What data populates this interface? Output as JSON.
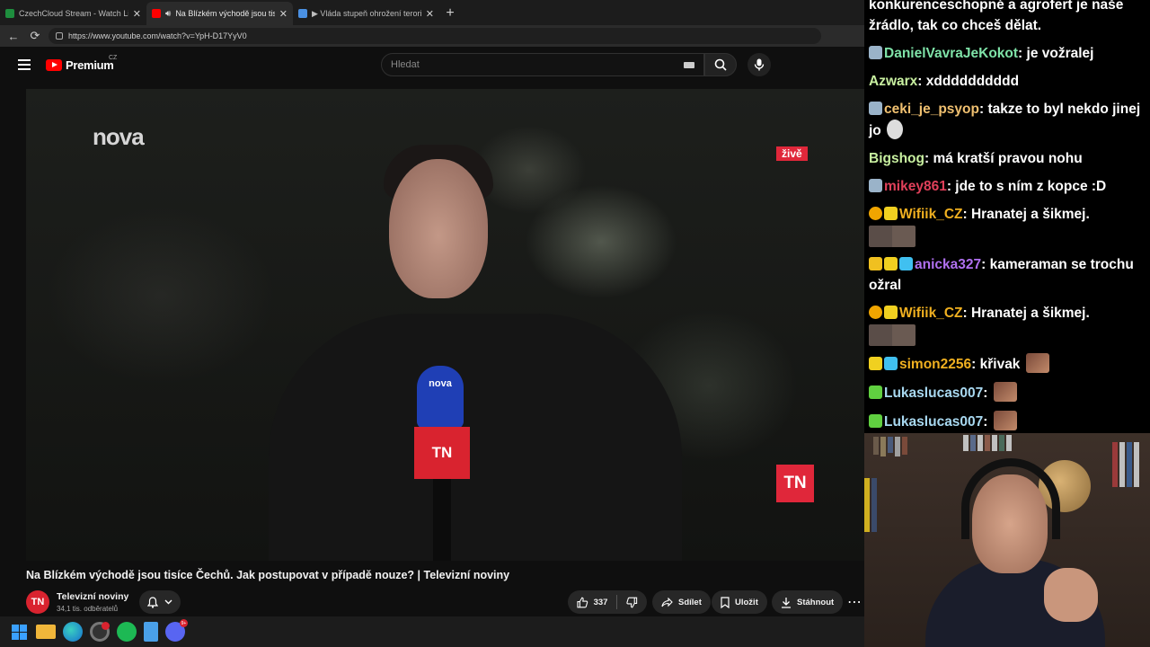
{
  "browser": {
    "tabs": [
      {
        "title": "CzechCloud Stream - Watch Live o",
        "favicon_color": "#1e8e3e",
        "active": false
      },
      {
        "title": "Na Blízkém východě jsou tisíce",
        "favicon_color": "#ff0000",
        "active": true
      },
      {
        "title": "▶ Vláda stupeň ohrožení terorism",
        "favicon_color": "#4a90e2",
        "active": false
      }
    ],
    "tab_close_glyph": "✕",
    "new_tab_glyph": "+",
    "url": "https://www.youtube.com/watch?v=YpH-D17YyV0"
  },
  "youtube": {
    "logo_text": "Premium",
    "region": "CZ",
    "search_placeholder": "Hledat",
    "video": {
      "channel_watermark": "nova",
      "live_badge": "živě",
      "corner_logo": "TN",
      "mic_logo": "nova",
      "mic_flag": "TN",
      "title": "Na Blízkém východě jsou tisíce Čechů. Jak postupovat v případě nouze? | Televizní noviny"
    },
    "channel": {
      "avatar": "TN",
      "name": "Televizní noviny",
      "subscribers": "34,1 tis. odběratelů"
    },
    "actions": {
      "likes": "337",
      "share": "Sdílet",
      "save": "Uložit",
      "download": "Stáhnout",
      "more": "⋯"
    }
  },
  "chat": {
    "messages": [
      {
        "continuation": true,
        "text": "konkurenceschopné a agrofert je naše žrádlo, tak co chceš dělat."
      },
      {
        "user": "DanielVavraJeKokot",
        "user_color": "#7fe3a8",
        "badges": [
          "#9ab3c9"
        ],
        "text": "je vožralej"
      },
      {
        "user": "Azwarx",
        "user_color": "#c8f0a0",
        "badges": [],
        "text": "xdddddddddd"
      },
      {
        "user": "ceki_je_psyop",
        "user_color": "#f0c070",
        "badges": [
          "#9ab3c9"
        ],
        "text": "takze to byl nekdo jinej jo"
      },
      {
        "user": "Bigshog",
        "user_color": "#c8f0a0",
        "badges": [],
        "text": "má kratší pravou nohu"
      },
      {
        "user": "mikey861",
        "user_color": "#e0405a",
        "badges": [
          "#9ab3c9"
        ],
        "text": "jde to s ním z kopce :D"
      },
      {
        "user": "Wifiik_CZ",
        "user_color": "#f0b020",
        "badges": [
          "#f0a500",
          "#f0d020"
        ],
        "text": "Hranatej a šikmej.",
        "emote_row": true
      },
      {
        "user": "anicka327",
        "user_color": "#b070f0",
        "badges": [
          "#f0c020",
          "#f0d020",
          "#40c0f0"
        ],
        "text": "kameraman se trochu ožral"
      },
      {
        "user": "Wifiik_CZ",
        "user_color": "#f0b020",
        "badges": [
          "#f0a500",
          "#f0d020"
        ],
        "text": "Hranatej a šikmej.",
        "emote_row": true
      },
      {
        "user": "simon2256",
        "user_color": "#f0b020",
        "badges": [
          "#f0d020",
          "#40c0f0"
        ],
        "text": "křivak",
        "emote": true
      },
      {
        "user": "Lukaslucas007",
        "user_color": "#a8d8f0",
        "badges": [
          "#60d040"
        ],
        "text": "",
        "emote": true
      },
      {
        "user": "Lukaslucas007",
        "user_color": "#a8d8f0",
        "badges": [
          "#60d040"
        ],
        "text": "",
        "emote": true
      }
    ]
  },
  "taskbar": {
    "icons": [
      "windows-icon",
      "file-explorer-icon",
      "edge-icon",
      "chrome-icon",
      "spotify-icon",
      "notepad-icon",
      "discord-icon"
    ],
    "discord_badge": "9+"
  }
}
